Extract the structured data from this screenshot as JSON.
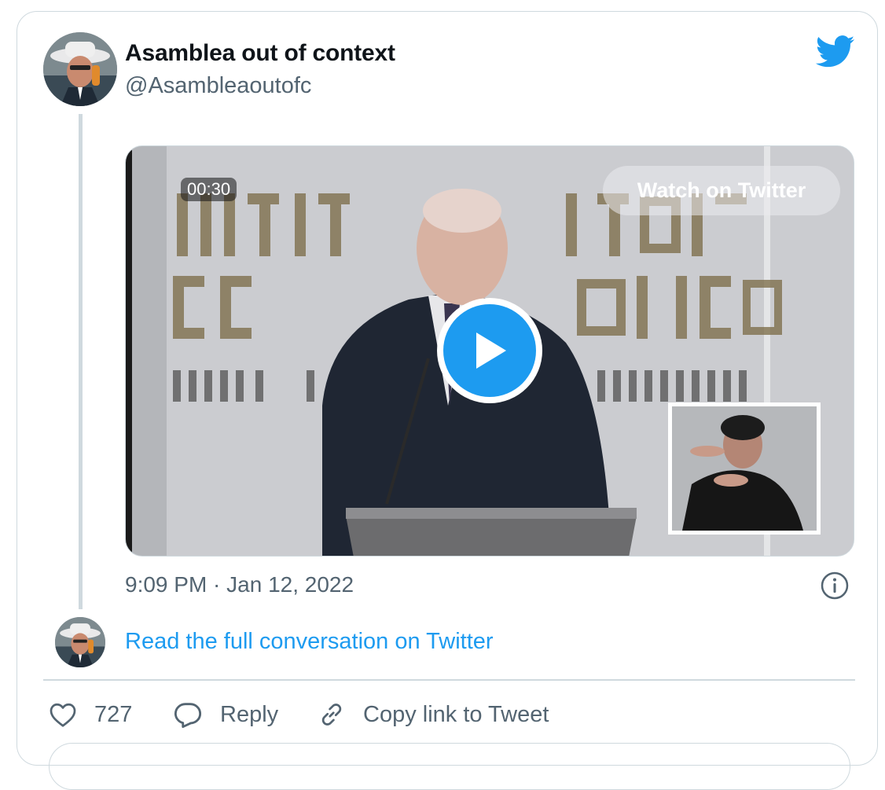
{
  "tweet": {
    "display_name": "Asamblea out of context",
    "handle": "@Asambleaoutofc",
    "time": "9:09 PM · Jan 12, 2022",
    "video": {
      "duration": "00:30",
      "watch_label": "Watch on Twitter"
    },
    "read_link": "Read the full conversation on Twitter"
  },
  "actions": {
    "like_count": "727",
    "reply_label": "Reply",
    "copy_label": "Copy link to Tweet"
  },
  "icons": {
    "brand": "twitter-bird-icon",
    "info": "info-icon",
    "like": "heart-icon",
    "reply": "speech-bubble-icon",
    "copy": "link-icon",
    "play": "play-icon"
  },
  "colors": {
    "accent": "#1d9bf0",
    "text": "#0f1419",
    "muted": "#536471",
    "border": "#cfd9de"
  }
}
